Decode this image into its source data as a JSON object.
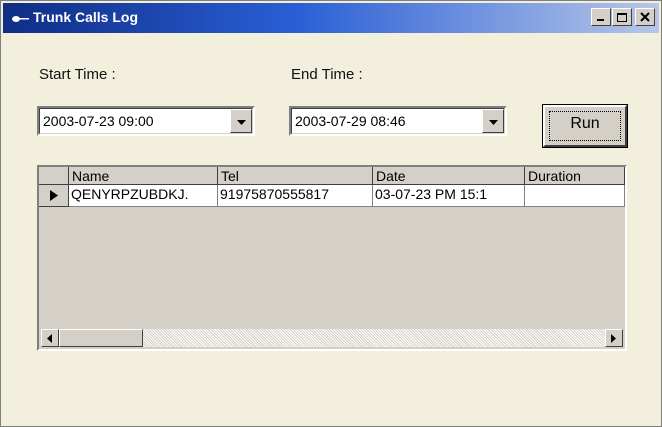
{
  "window": {
    "title": "Trunk Calls Log",
    "title_icon": "phone-handset-icon",
    "controls": [
      "minimize-icon",
      "maximize-icon",
      "close-icon"
    ]
  },
  "form": {
    "start_label": "Start Time :",
    "start_value": "2003-07-23 09:00",
    "end_label": "End Time :",
    "end_value": "2003-07-29 08:46",
    "run_label": "Run"
  },
  "grid": {
    "columns": [
      "Name",
      "Tel",
      "Date",
      "Duration"
    ],
    "rows": [
      [
        "QENYRPZUBDKJ.",
        "91975870555817",
        "03-07-23 PM 15:1",
        ""
      ]
    ],
    "current_row_icon": "row-pointer-icon"
  },
  "colors": {
    "title_bar_start": "#0f2d85",
    "title_bar_end": "#b8c7e8",
    "window_bg": "#f3efdd",
    "control_face": "#d4d0c8"
  }
}
